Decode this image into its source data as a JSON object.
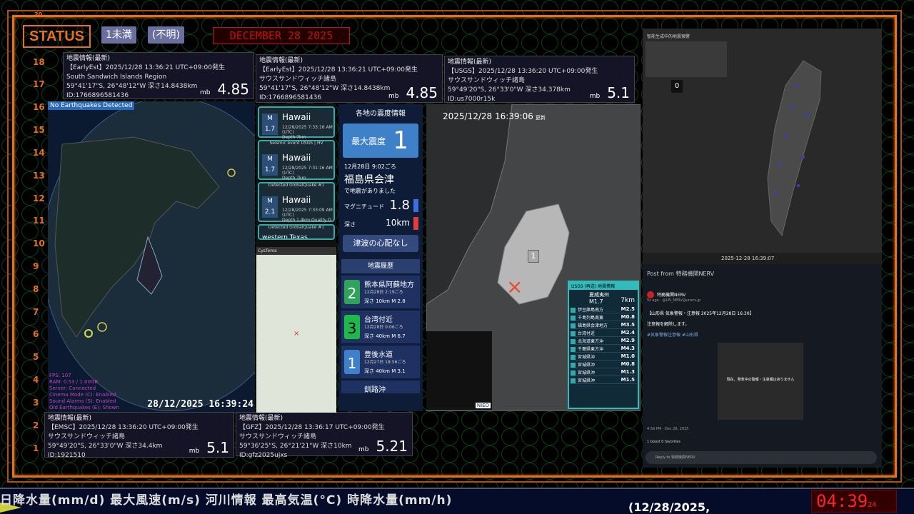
{
  "status": {
    "title": "STATUS",
    "badge1": "1未満",
    "badge2": "(不明)",
    "date": "DECEMBER 28 2025",
    "ruler_top": "20"
  },
  "ruler": [
    "18",
    "17",
    "16",
    "15",
    "14",
    "13",
    "12",
    "11",
    "10",
    "9",
    "8",
    "7",
    "6",
    "5",
    "4",
    "3",
    "2",
    "1"
  ],
  "cards": [
    {
      "hdr": "地震情報(最新)",
      "src": "【EarlyEst】2025/12/28 13:36:21 UTC+09:00発生",
      "region": "South Sandwich Islands Region",
      "coords": "59°41'17\"S, 26°48'12\"W 深さ14.8438km",
      "id": "ID:1766896581436",
      "mlabel": "mb",
      "mag": "4.85"
    },
    {
      "hdr": "地震情報(最新)",
      "src": "【EarlyEst】2025/12/28 13:36:21 UTC+09:00発生",
      "region": "サウスサンドウィッチ諸島",
      "coords": "59°41'17\"S, 26°48'12\"W 深さ14.8438km",
      "id": "ID:1766896581436",
      "mlabel": "mb",
      "mag": "4.85"
    },
    {
      "hdr": "地震情報(最新)",
      "src": "【USGS】2025/12/28 13:36:20 UTC+09:00発生",
      "region": "サウスサンドウィッチ諸島",
      "coords": "59°49'20\"S, 26°33'0\"W 深さ34.378km",
      "id": "ID:us7000r15k",
      "mlabel": "mb",
      "mag": "5.1"
    },
    {
      "hdr": "地震情報(最新)",
      "src": "【EMSC】2025/12/28 13:36:20 UTC+09:00発生",
      "region": "サウスサンドウィッチ諸島",
      "coords": "59°49'20\"S, 26°33'0\"W 深さ34.4km",
      "id": "ID:1921510",
      "mlabel": "mb",
      "mag": "5.1"
    },
    {
      "hdr": "地震情報(最新)",
      "src": "【GFZ】2025/12/28 13:36:17 UTC+09:00発生",
      "region": "サウスサンドウィッチ諸島",
      "coords": "59°36'25\"S, 26°21'21\"W 深さ10km",
      "id": "ID:gfz2025ujxs",
      "mlabel": "mb",
      "mag": "5.21"
    }
  ],
  "globe": {
    "tag": "No Earthquakes Detected",
    "info": [
      "FPS: 107",
      "RAM: 0.53 / 1.00GB",
      "Server: Connected",
      "Cinema Mode (C): Enabled",
      "Sound Alarms (S): Enabled",
      "Old Earthquakes (E): Shown"
    ],
    "time": "28/12/2025 16:39:24"
  },
  "feed": [
    {
      "top": "",
      "m": "M\n1.7",
      "name": "Hawaii",
      "sub": "12/28/2025 7:33:16 AM (UTC)\nDepth 7km"
    },
    {
      "top": "Seismic event  USGS | HV",
      "m": "M\n1.7",
      "name": "Hawaii",
      "sub": "12/28/2025 7:31:16 AM (UTC)\nDepth 7km"
    },
    {
      "top": "Detected  GlobalQuake  #1",
      "m": "M\n2.1",
      "name": "Hawaii",
      "sub": "12/28/2025 7:33:09 AM (UTC)\nDepth 1.4km  Quality D"
    },
    {
      "top": "Detected  GlobalQuake  #1",
      "m": "",
      "name": "western Texas",
      "sub": ""
    }
  ],
  "cystema": "CysTema",
  "shindo": {
    "title": "各地の震度情報",
    "max_label": "最大震度",
    "max": "1",
    "date": "12月28日 9:02ごろ",
    "place": "福島県会津",
    "msg": "で地震がありました",
    "mag_label": "マグニチュード",
    "mag": "1.8",
    "depth_label": "深さ",
    "depth": "10km",
    "tsunami": "津波の心配なし",
    "hist_title": "地震履歴",
    "hist": [
      {
        "lv": "2",
        "name": "熊本県阿蘇地方",
        "date": "12月28日 2:19ごろ",
        "depth": "深さ 10km",
        "mag": "M 2.8",
        "color": "#2fa35a"
      },
      {
        "lv": "3",
        "name": "台湾付近",
        "date": "12月28日 0:06ごろ",
        "depth": "深さ 40km",
        "mag": "M 6.7",
        "color": "#1fb84a"
      },
      {
        "lv": "1",
        "name": "豊後水道",
        "date": "12月27日 18:56ごろ",
        "depth": "深さ 40km",
        "mag": "M 3.1",
        "color": "#3f81c8"
      },
      {
        "lv": "",
        "name": "釧路沖",
        "date": "",
        "depth": "",
        "mag": "",
        "color": "#3f81c8"
      }
    ]
  },
  "map2": {
    "time": "2025/12/28 16:39:06",
    "update": "更新",
    "marker": "1",
    "nied": "NIED"
  },
  "usgs": {
    "hdr": "USGS (再送) 地震情報",
    "place": "夏威夷州",
    "mag": "M1.7",
    "depth": "7km",
    "rows": [
      [
        "伊豆諸島南方",
        "M2.5"
      ],
      [
        "千島列島南東",
        "M0.8"
      ],
      [
        "福島県会津地方",
        "M3.5"
      ],
      [
        "台湾付近",
        "M2.4"
      ],
      [
        "北海道東方沖",
        "M2.9"
      ],
      [
        "千葉県東方沖",
        "M4.3"
      ],
      [
        "宮城県沖",
        "M1.0"
      ],
      [
        "宮城県沖",
        "M0.8"
      ],
      [
        "宮城県沖",
        "M1.3"
      ],
      [
        "宮城県沖",
        "M1.5"
      ]
    ]
  },
  "right": {
    "title": "智能生成中的地震預警",
    "time": "2025-12-28 16:39:07",
    "zero": "0"
  },
  "tweet": {
    "header": "Post from 特務機関NERV",
    "name": "特務機関NERV",
    "handle": "5s ago · @UN_NERV@unerv.jp",
    "body1": "【山形県 気象警報・注意報 2025年12月28日 16:30】",
    "body2": "注意報を解除します。",
    "tags": "#気象警報注意報 #山形県",
    "img_text": "現在、発表中の警報・注意報はありません",
    "footer": "4:58 PM · Dec 28, 2025",
    "counts": "1 boost  0 favorites",
    "reply": "Reply to 特務機関NERV"
  },
  "ticker": "日降水量(mm/d)  最大風速(m/s)   河川情報       最高気温(°C)    時降水量(mm/h)",
  "ticker2": "(12/28/2025,",
  "clock": "04:39",
  "clock_small": "24"
}
